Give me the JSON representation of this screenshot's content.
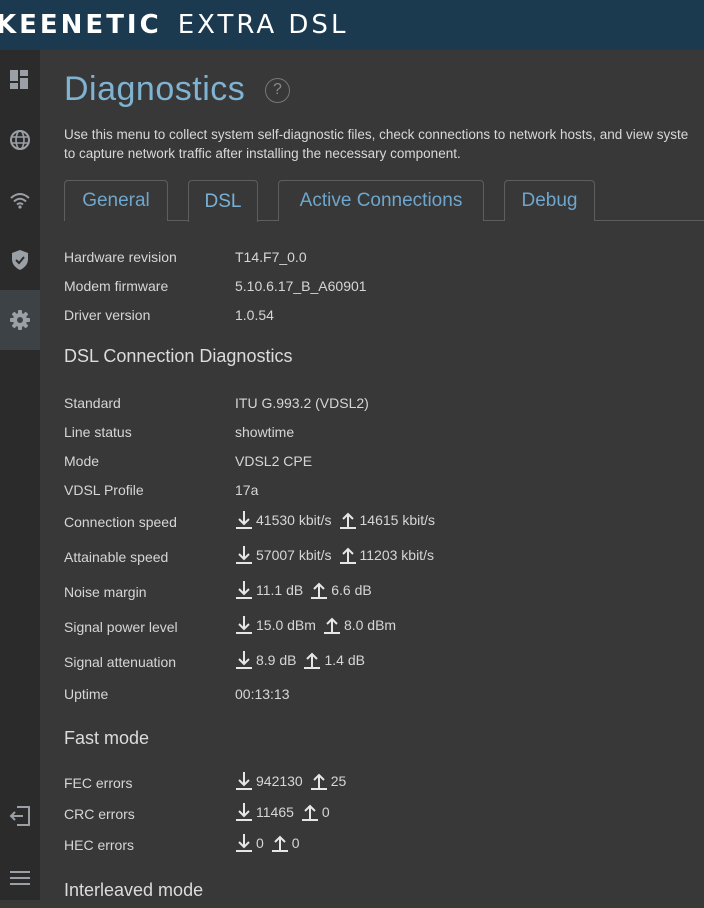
{
  "brand": {
    "part1": "KEENETIC",
    "part2": "EXTRA DSL"
  },
  "sidebar": {
    "items": [
      {
        "icon": "dashboard-icon"
      },
      {
        "icon": "globe-icon"
      },
      {
        "icon": "wifi-icon"
      },
      {
        "icon": "shield-icon"
      },
      {
        "icon": "gear-icon",
        "active": true
      },
      {
        "icon": "logout-icon"
      },
      {
        "icon": "menu-icon"
      }
    ]
  },
  "page": {
    "title": "Diagnostics",
    "help": "?",
    "description_line1": "Use this menu to collect system self-diagnostic files, check connections to network hosts, and view syste",
    "description_line2": "to capture network traffic after installing the necessary component."
  },
  "tabs": [
    {
      "label": "General"
    },
    {
      "label": "DSL",
      "active": true
    },
    {
      "label": "Active Connections"
    },
    {
      "label": "Debug"
    }
  ],
  "info": {
    "hardware_revision": {
      "label": "Hardware revision",
      "value": "T14.F7_0.0"
    },
    "modem_firmware": {
      "label": "Modem firmware",
      "value": "5.10.6.17_B_A60901"
    },
    "driver_version": {
      "label": "Driver version",
      "value": "1.0.54"
    }
  },
  "dsl": {
    "heading": "DSL Connection Diagnostics",
    "standard": {
      "label": "Standard",
      "value": "ITU G.993.2 (VDSL2)"
    },
    "line_status": {
      "label": "Line status",
      "value": "showtime"
    },
    "mode": {
      "label": "Mode",
      "value": "VDSL2 CPE"
    },
    "profile": {
      "label": "VDSL Profile",
      "value": "17a"
    },
    "connection_speed": {
      "label": "Connection speed",
      "down": "41530 kbit/s",
      "up": "14615 kbit/s"
    },
    "attainable_speed": {
      "label": "Attainable speed",
      "down": "57007 kbit/s",
      "up": "11203 kbit/s"
    },
    "noise_margin": {
      "label": "Noise margin",
      "down": "11.1 dB",
      "up": "6.6 dB"
    },
    "signal_power": {
      "label": "Signal power level",
      "down": "15.0 dBm",
      "up": "8.0 dBm"
    },
    "signal_attenuation": {
      "label": "Signal attenuation",
      "down": "8.9 dB",
      "up": "1.4 dB"
    },
    "uptime": {
      "label": "Uptime",
      "value": "00:13:13"
    }
  },
  "fast": {
    "heading": "Fast mode",
    "fec": {
      "label": "FEC errors",
      "down": "942130",
      "up": "25"
    },
    "crc": {
      "label": "CRC errors",
      "down": "11465",
      "up": "0"
    },
    "hec": {
      "label": "HEC errors",
      "down": "0",
      "up": "0"
    }
  },
  "interleaved": {
    "heading": "Interleaved mode"
  },
  "colors": {
    "topbar": "#1c3a4f",
    "sidebar": "#2b2b2b",
    "background": "#383838",
    "accent": "#7fb3d3"
  }
}
